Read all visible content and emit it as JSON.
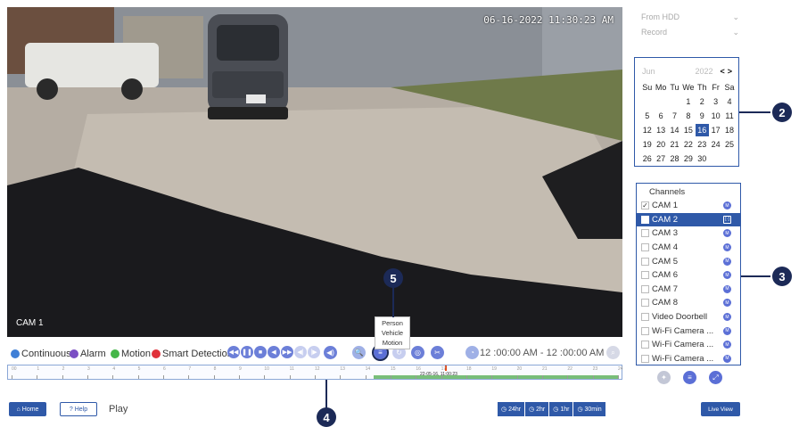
{
  "video": {
    "timestamp": "06-16-2022 11:30:23 AM",
    "camera_label": "CAM 1"
  },
  "legend": {
    "continuous": "Continuous",
    "alarm": "Alarm",
    "motion": "Motion",
    "smart_detection": "Smart Detection",
    "colors": {
      "continuous": "#3f7fd6",
      "alarm": "#7b4fc4",
      "motion": "#45b649",
      "smart": "#e0313a"
    }
  },
  "popup_menu": [
    "Person",
    "Vehicle",
    "Motion"
  ],
  "time_range": "12 :00:00 AM  -  12 :00:00 AM",
  "timeline": {
    "ticks": [
      "00",
      "1",
      "2",
      "3",
      "4",
      "5",
      "6",
      "7",
      "8",
      "9",
      "10",
      "11",
      "12",
      "13",
      "14",
      "15",
      "16",
      "17",
      "18",
      "19",
      "20",
      "21",
      "22",
      "23",
      "24"
    ],
    "current_time": "22-05-16, 11:00:23"
  },
  "bottom": {
    "home": "Home",
    "help": "? Help",
    "play": "Play",
    "zoom": [
      "24hr",
      "2hr",
      "1hr",
      "30min"
    ],
    "live_view": "Live View"
  },
  "right_panel": {
    "source": "From HDD",
    "mode": "Record"
  },
  "calendar": {
    "month": "Jun",
    "year": "2022",
    "weekdays": [
      "Su",
      "Mo",
      "Tu",
      "We",
      "Th",
      "Fr",
      "Sa"
    ],
    "days": [
      "",
      "",
      "",
      "1",
      "2",
      "3",
      "4",
      "5",
      "6",
      "7",
      "8",
      "9",
      "10",
      "11",
      "12",
      "13",
      "14",
      "15",
      "16",
      "17",
      "18",
      "19",
      "20",
      "21",
      "22",
      "23",
      "24",
      "25",
      "26",
      "27",
      "28",
      "29",
      "30",
      "",
      ""
    ],
    "selected_day": "16"
  },
  "channels": {
    "title": "Channels",
    "items": [
      {
        "label": "CAM 1",
        "checked": "✓",
        "badge": "M"
      },
      {
        "label": "CAM 2",
        "checked": "",
        "badge": "[·]"
      },
      {
        "label": "CAM 3",
        "checked": "",
        "badge": "M"
      },
      {
        "label": "CAM 4",
        "checked": "",
        "badge": "M"
      },
      {
        "label": "CAM 5",
        "checked": "",
        "badge": "M"
      },
      {
        "label": "CAM 6",
        "checked": "",
        "badge": "M"
      },
      {
        "label": "CAM 7",
        "checked": "",
        "badge": "M"
      },
      {
        "label": "CAM 8",
        "checked": "",
        "badge": "M"
      },
      {
        "label": "Video Doorbell",
        "checked": "",
        "badge": "M"
      },
      {
        "label": "Wi-Fi Camera ...",
        "checked": "",
        "badge": "M"
      },
      {
        "label": "Wi-Fi Camera ...",
        "checked": "",
        "badge": "M"
      },
      {
        "label": "Wi-Fi Camera ...",
        "checked": "",
        "badge": "M"
      }
    ],
    "selected_index": 1
  },
  "callouts": {
    "c2": "2",
    "c3": "3",
    "c4": "4",
    "c5": "5"
  }
}
